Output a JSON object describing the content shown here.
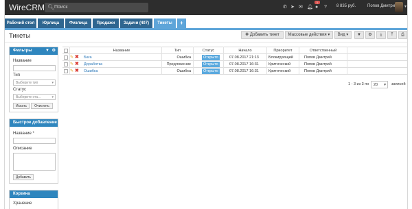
{
  "header": {
    "logo": "WireCRM",
    "search_placeholder": "Поиск",
    "badge": "1",
    "balance": "8 835 руб.",
    "user": "Попов Дмитрий"
  },
  "tabs": [
    {
      "label": "Рабочий стол"
    },
    {
      "label": "Юрлица"
    },
    {
      "label": "Физлица"
    },
    {
      "label": "Продажи"
    },
    {
      "label": "Задачи (407)"
    },
    {
      "label": "Тикеты"
    },
    {
      "label": "+"
    }
  ],
  "page": {
    "title": "Тикеты"
  },
  "toolbar": {
    "add": "✚ Добавить тикет",
    "mass": "Массовые действия ▾",
    "view": "Вид ▾"
  },
  "filters": {
    "title": "Фильтры",
    "name_label": "Название",
    "type_label": "Тип",
    "type_placeholder": "Выберите тип",
    "status_label": "Статус",
    "status_placeholder": "Выберите ста...",
    "search_btn": "Искать",
    "clear_btn": "Очистить"
  },
  "quick_add": {
    "title": "Быстрое добавление",
    "name_label": "Название *",
    "desc_label": "Описание",
    "add_btn": "Добавить"
  },
  "cart": {
    "title": "Корзина",
    "text": "Хранение"
  },
  "table": {
    "headers": [
      "Название",
      "Тип",
      "Статус",
      "Начало",
      "Приоритет",
      "Ответственный"
    ],
    "rows": [
      {
        "name": "Бага",
        "type": "Ошибка",
        "status": "Открыто",
        "start": "07.08.2017 21:13",
        "priority": "Блокирующий",
        "owner": "Попов Дмитрий"
      },
      {
        "name": "Доработка",
        "type": "Предложение",
        "status": "Открыто",
        "start": "07.08.2017 16:31",
        "priority": "Критический",
        "owner": "Попов Дмитрий"
      },
      {
        "name": "Ошибка",
        "type": "Ошибка",
        "status": "Открыто",
        "start": "07.08.2017 16:31",
        "priority": "Критический",
        "owner": "Попов Дмитрий"
      }
    ]
  },
  "pager": {
    "range": "1 - 3 из 3 по",
    "per_page": "20",
    "suffix": "записей"
  },
  "colors": {
    "tab": "#2f6690",
    "tab_active": "#5ea5d9",
    "status": "#5aa9de",
    "link": "#2a77b8"
  }
}
